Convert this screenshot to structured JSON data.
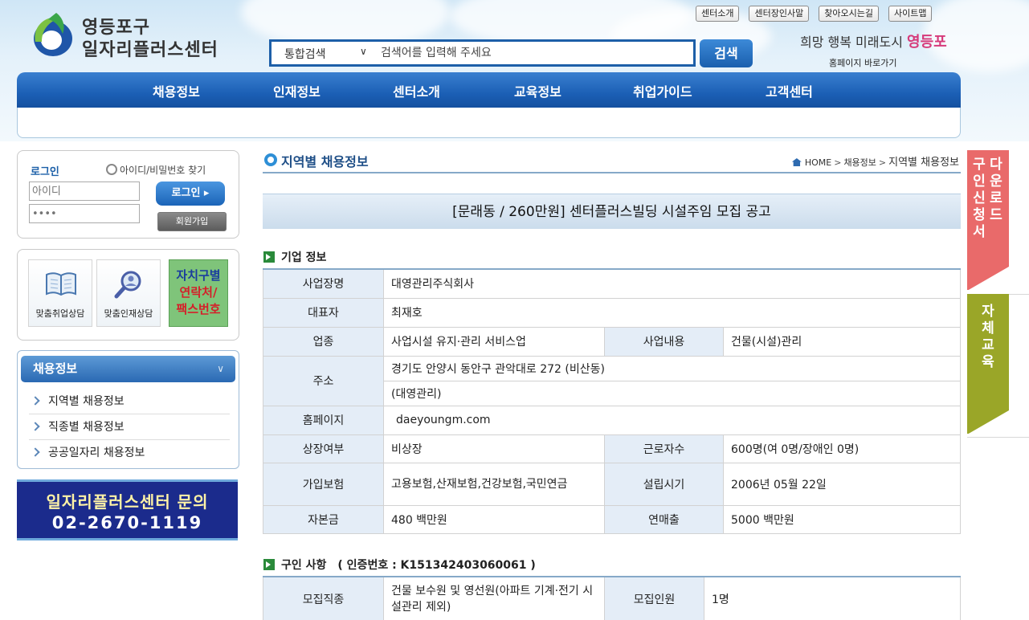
{
  "header": {
    "logo_line1": "영등포구",
    "logo_line2": "일자리플러스센터",
    "top_links": [
      "센터소개",
      "센터장인사말",
      "찾아오시는길",
      "사이트맵"
    ],
    "search_scope": "통합검색",
    "search_placeholder": "검색어를 입력해 주세요",
    "search_button": "검색",
    "slogan_prefix": "희망 행복 미래도시 ",
    "slogan_emph": "영등포",
    "slogan_sub": "홈페이지 바로가기"
  },
  "nav": {
    "items": [
      "채용정보",
      "인재정보",
      "센터소개",
      "교육정보",
      "취업가이드",
      "고객센터"
    ]
  },
  "login": {
    "title": "로그인",
    "find": "아이디/비밀번호 찾기",
    "id_placeholder": "아이디",
    "pw_placeholder": "••••",
    "login_button": "로그인 ▸",
    "join_button": "회원가입"
  },
  "quick": {
    "job_consult": "맞춤취업상담",
    "talent_consult": "맞춤인재상담",
    "contact_l1": "자치구별",
    "contact_l2": "연락처/",
    "contact_l3": "팩스번호"
  },
  "jobmenu": {
    "title": "채용정보",
    "items": [
      "지역별 채용정보",
      "직종별 채용정보",
      "공공일자리 채용정보"
    ]
  },
  "inquiry": {
    "line1": "일자리플러스센터 문의",
    "line2": "02-2670-1119"
  },
  "page": {
    "title": "지역별 채용정보",
    "breadcrumb": [
      "HOME",
      "채용정보",
      "지역별 채용정보"
    ],
    "post_title": "[문래동 / 260만원] 센터플러스빌딩 시설주임 모집 공고"
  },
  "company": {
    "section_title": "기업 정보",
    "labels": {
      "name": "사업장명",
      "ceo": "대표자",
      "industry": "업종",
      "business": "사업내용",
      "address": "주소",
      "homepage": "홈페이지",
      "listed": "상장여부",
      "employees": "근로자수",
      "insurance": "가입보험",
      "founded": "설립시기",
      "capital": "자본금",
      "revenue": "연매출"
    },
    "values": {
      "name": "대영관리주식회사",
      "ceo": "최재호",
      "industry": "사업시설 유지·관리 서비스업",
      "business": "건물(시설)관리",
      "address1": "경기도 안양시 동안구 관악대로 272 (비산동)",
      "address2": "(대영관리)",
      "homepage": "daeyoungm.com",
      "listed": "비상장",
      "employees": "600명(여 0명/장애인 0명)",
      "insurance": "고용보험,산재보험,건강보험,국민연금",
      "founded": "2006년 05월 22일",
      "capital": "480 백만원",
      "revenue": "5000 백만원"
    }
  },
  "recruit": {
    "section_title": "구인 사항",
    "cert": "( 인증번호 : K151342403060061 )",
    "labels": {
      "job": "모집직종",
      "count": "모집인원"
    },
    "values": {
      "job": "건물 보수원 및 영선원(아파트 기계·전기 시설관리 제외)",
      "count": "1명"
    }
  },
  "side_tabs": {
    "tab1_col_a": "구인신청서",
    "tab1_col_b": "다운로드",
    "tab2": "자체교육"
  },
  "colors": {
    "brand_blue": "#1d5fa8",
    "tab_red": "#e96a6a",
    "tab_olive": "#9aa628",
    "inquiry_navy": "#1b2b8c"
  }
}
